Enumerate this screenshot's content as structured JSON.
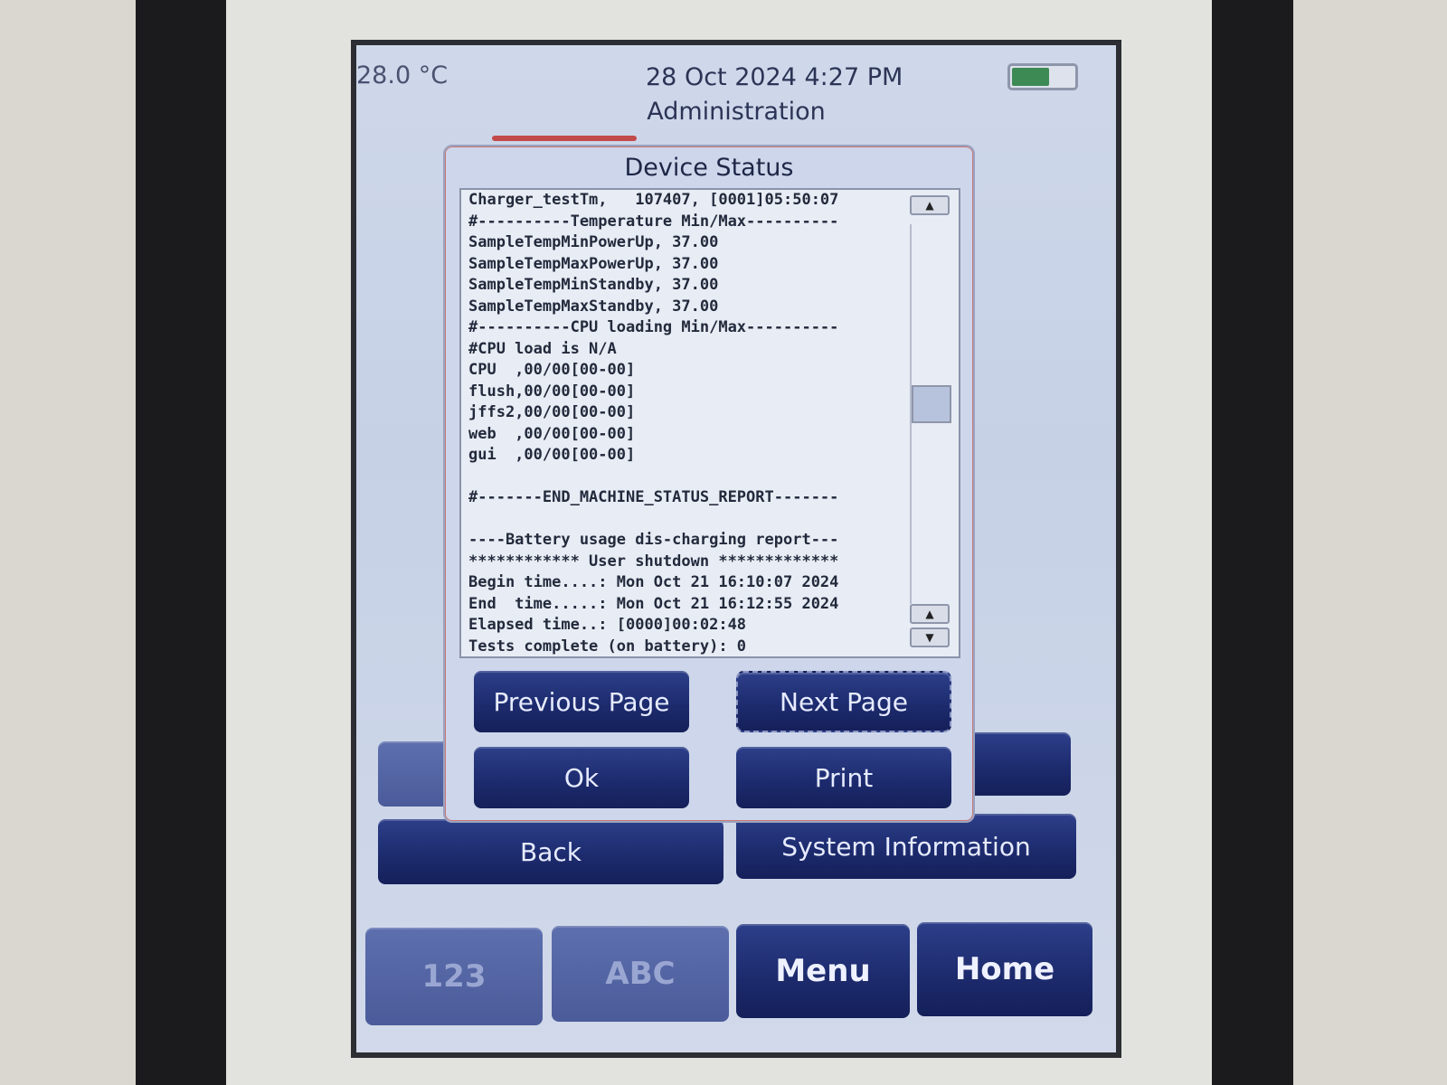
{
  "status_bar": {
    "temperature": "28.0 °C",
    "datetime": "28 Oct 2024 4:27 PM",
    "battery_level": 0.6
  },
  "page": {
    "title": "Administration"
  },
  "dialog": {
    "title": "Device Status",
    "log_lines": [
      "Charger_testTm,   107407, [0001]05:50:07",
      "#----------Temperature Min/Max----------",
      "SampleTempMinPowerUp, 37.00",
      "SampleTempMaxPowerUp, 37.00",
      "SampleTempMinStandby, 37.00",
      "SampleTempMaxStandby, 37.00",
      "#----------CPU loading Min/Max----------",
      "#CPU load is N/A",
      "CPU  ,00/00[00-00]",
      "flush,00/00[00-00]",
      "jffs2,00/00[00-00]",
      "web  ,00/00[00-00]",
      "gui  ,00/00[00-00]",
      "",
      "#-------END_MACHINE_STATUS_REPORT-------",
      "",
      "----Battery usage dis-charging report---",
      "************ User shutdown *************",
      "Begin time....: Mon Oct 21 16:10:07 2024",
      "End  time.....: Mon Oct 21 16:12:55 2024",
      "Elapsed time..: [0000]00:02:48",
      "Tests complete (on battery): 0"
    ],
    "buttons": {
      "previous": "Previous Page",
      "next": "Next Page",
      "ok": "Ok",
      "print": "Print"
    }
  },
  "main_buttons": {
    "back": "Back",
    "system_information": "System Information"
  },
  "bottom_bar": {
    "numeric": "123",
    "alpha": "ABC",
    "menu": "Menu",
    "home": "Home"
  },
  "colors": {
    "button_dark": "#1c2a6c",
    "screen_bg": "#c6d1e6",
    "battery_green": "#3e8a54",
    "dialog_accent": "#c24a4a"
  }
}
